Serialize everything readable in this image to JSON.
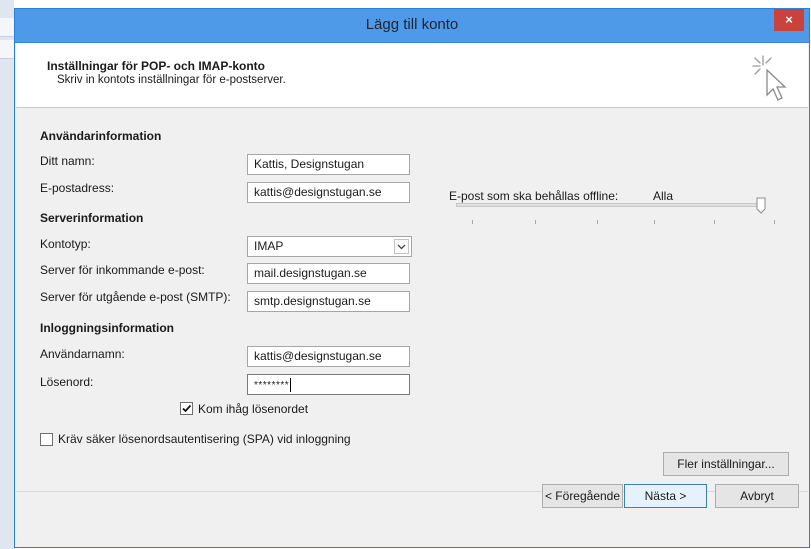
{
  "window": {
    "title": "Lägg till konto",
    "close_label": "×"
  },
  "header": {
    "title": "Inställningar för POP- och IMAP-konto",
    "subtitle": "Skriv in kontots inställningar för e-postserver."
  },
  "user_info": {
    "heading": "Användarinformation",
    "name_label": "Ditt namn:",
    "name_value": "Kattis, Designstugan",
    "email_label": "E-postadress:",
    "email_value": "kattis@designstugan.se"
  },
  "server_info": {
    "heading": "Serverinformation",
    "account_type_label": "Kontotyp:",
    "account_type_value": "IMAP",
    "incoming_label": "Server för inkommande e-post:",
    "incoming_value": "mail.designstugan.se",
    "outgoing_label": "Server för utgående e-post (SMTP):",
    "outgoing_value": "smtp.designstugan.se"
  },
  "login_info": {
    "heading": "Inloggningsinformation",
    "username_label": "Användarnamn:",
    "username_value": "kattis@designstugan.se",
    "password_label": "Lösenord:",
    "password_value": "********",
    "remember_label": "Kom ihåg lösenordet",
    "remember_checked": true,
    "spa_label": "Kräv säker lösenordsautentisering (SPA) vid inloggning",
    "spa_checked": false
  },
  "offline": {
    "label": "E-post som ska behållas offline:",
    "value": "Alla"
  },
  "buttons": {
    "more_settings": "Fler inställningar...",
    "back": "< Föregående",
    "next": "Nästa >",
    "cancel": "Avbryt"
  },
  "colors": {
    "titlebar": "#4f9ae8",
    "close": "#c9423b",
    "dialog_bg": "#f0f0f0"
  }
}
